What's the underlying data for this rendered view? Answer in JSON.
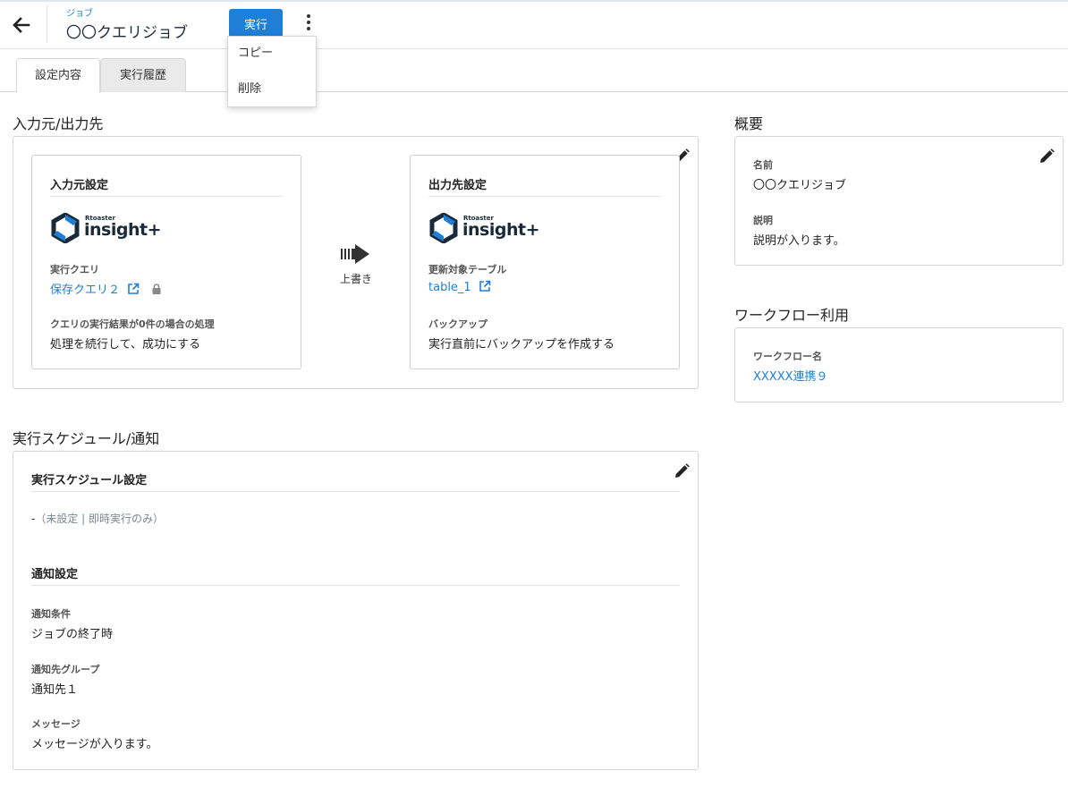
{
  "header": {
    "subtitle": "ジョブ",
    "title": "〇〇クエリジョブ",
    "run_label": "実行"
  },
  "menu": {
    "items": [
      "コピー",
      "削除"
    ]
  },
  "tabs": [
    {
      "label": "設定内容",
      "active": true
    },
    {
      "label": "実行履歴",
      "active": false
    }
  ],
  "io": {
    "section_title": "入力元/出力先",
    "source": {
      "title": "入力元設定",
      "logo_small": "Rtoaster",
      "logo": "insight+",
      "query_label": "実行クエリ",
      "query_value": "保存クエリ２",
      "zero_label": "クエリの実行結果が0件の場合の処理",
      "zero_value": "処理を続行して、成功にする"
    },
    "mode_label": "上書き",
    "destination": {
      "title": "出力先設定",
      "logo_small": "Rtoaster",
      "logo": "insight+",
      "table_label": "更新対象テーブル",
      "table_value": "table_1",
      "backup_label": "バックアップ",
      "backup_value": "実行直前にバックアップを作成する"
    }
  },
  "schedule": {
    "section_title": "実行スケジュール/通知",
    "schedule_title": "実行スケジュール設定",
    "schedule_dash": "-",
    "schedule_value": "（未設定 | 即時実行のみ）",
    "notify_title": "通知設定",
    "cond_label": "通知条件",
    "cond_value": "ジョブの終了時",
    "group_label": "通知先グループ",
    "group_value": "通知先１",
    "message_label": "メッセージ",
    "message_value": "メッセージが入ります。"
  },
  "overview": {
    "section_title": "概要",
    "name_label": "名前",
    "name_value": "〇〇クエリジョブ",
    "desc_label": "説明",
    "desc_value": "説明が入ります。"
  },
  "workflow": {
    "section_title": "ワークフロー利用",
    "name_label": "ワークフロー名",
    "name_value": "XXXXX連携９"
  },
  "colors": {
    "accent": "#1f7fd6",
    "text": "#222222",
    "muted": "#7a8694",
    "border": "#d4d4d4"
  },
  "icons": [
    "back-arrow-icon",
    "kebab-menu-icon",
    "pencil-icon",
    "external-link-icon",
    "lock-icon",
    "arrow-right-icon",
    "insight-logo-icon"
  ]
}
